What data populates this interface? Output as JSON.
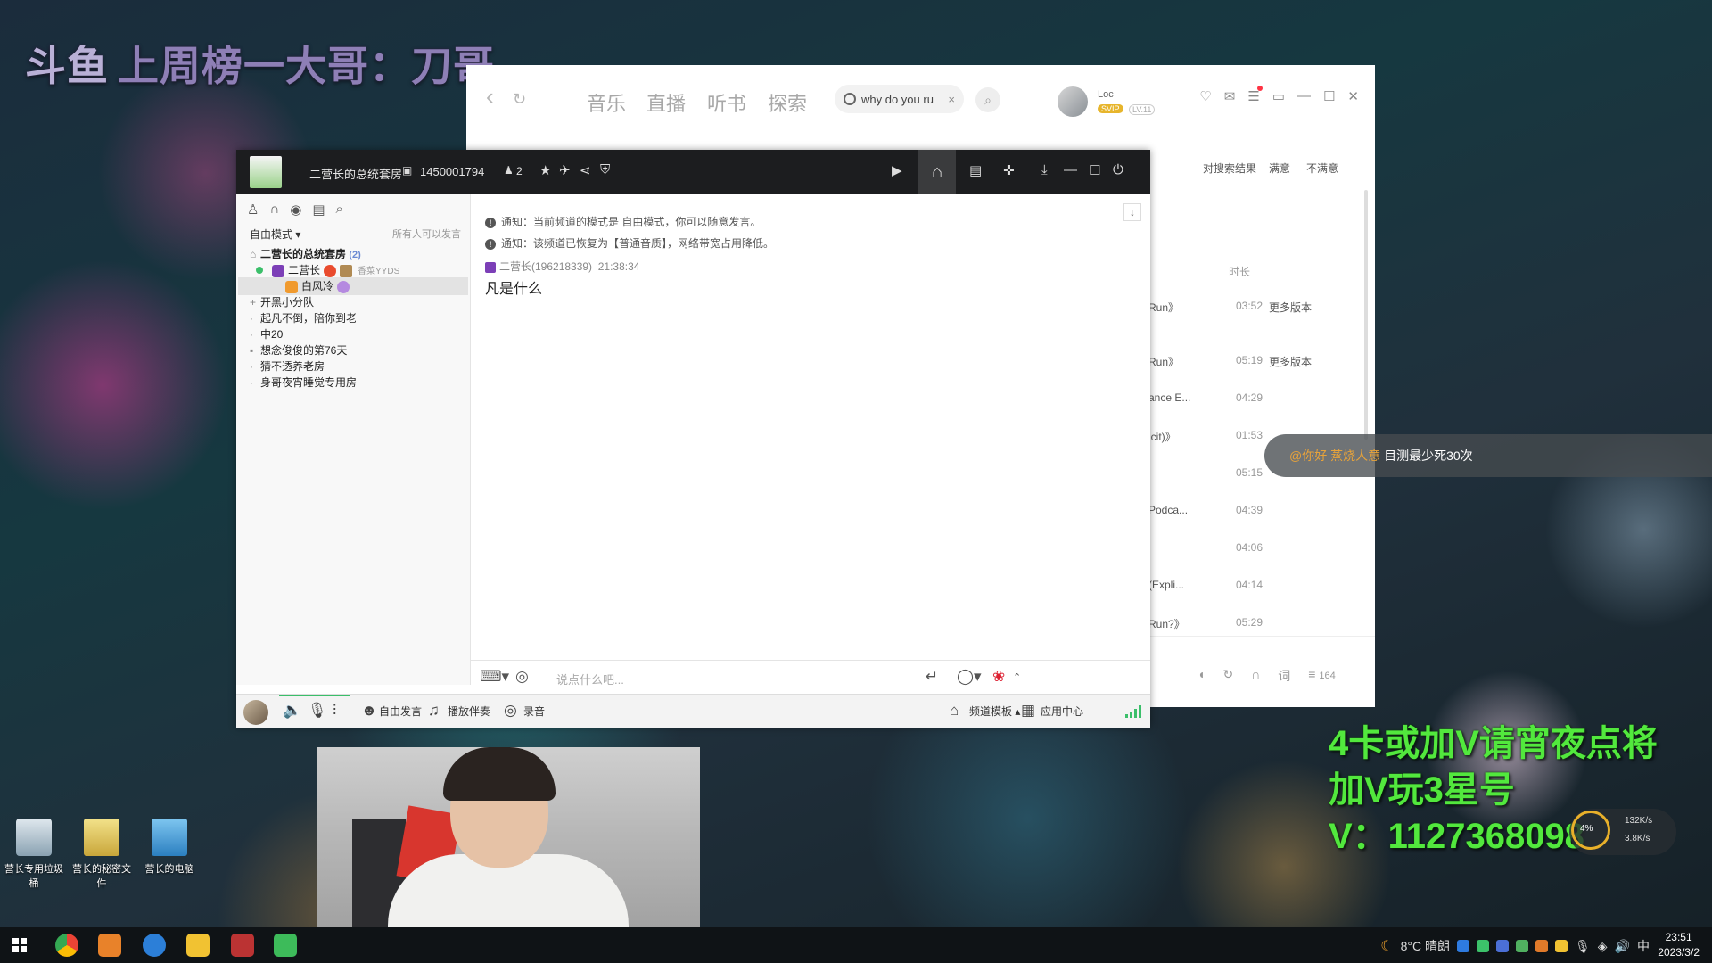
{
  "overlay_top": {
    "logo": "斗鱼",
    "text": "上周榜一大哥：刀哥"
  },
  "music_app": {
    "tabs": [
      "音乐",
      "直播",
      "听书",
      "探索"
    ],
    "search_value": "why do you ru",
    "user_name": "Loc",
    "svip": "SVIP",
    "level": "LV.11",
    "feedback": {
      "question": "对搜索结果",
      "satisfied": "满意",
      "unsatisfied": "不满意"
    },
    "duration_header": "时长",
    "songs": [
      {
        "title": "Run》",
        "duration": "03:52",
        "more": "更多版本"
      },
      {
        "title": "Run》",
        "duration": "05:19",
        "more": "更多版本"
      },
      {
        "title": "ance E...",
        "duration": "04:29",
        "more": ""
      },
      {
        "title": "icit)》",
        "duration": "01:53",
        "more": ""
      },
      {
        "title": "",
        "duration": "05:15",
        "more": ""
      },
      {
        "title": "Podca...",
        "duration": "04:39",
        "more": ""
      },
      {
        "title": "",
        "duration": "04:06",
        "more": ""
      },
      {
        "title": "(Expli...",
        "duration": "04:14",
        "more": ""
      },
      {
        "title": "Run?》",
        "duration": "05:29",
        "more": ""
      }
    ],
    "playlist_count": "164"
  },
  "chat_pill": {
    "user": "@你好 蒸烧人意",
    "message": "目测最少死30次"
  },
  "yy": {
    "room_name": "二营长的总统套房",
    "room_id": "1450001794",
    "online_count": "2",
    "mode": "自由模式",
    "permission": "所有人可以发言",
    "channel_main": "二营长的总统套房",
    "channel_main_count": "(2)",
    "members": [
      {
        "name": "二营长",
        "tag": "香菜YYDS"
      },
      {
        "name": "白风冷",
        "tag": ""
      }
    ],
    "sub_channels": [
      "开黑小分队",
      "起凡不倒，陪你到老",
      "中20",
      "想念俊俊的第76天",
      "猜不透养老房",
      "身哥夜宵睡觉专用房"
    ],
    "notices": [
      "通知：当前频道的模式是 自由模式，你可以随意发言。",
      "通知：该频道已恢复为【普通音质】，网络带宽占用降低。"
    ],
    "message": {
      "sender": "二营长(196218339)",
      "time": "21:38:34",
      "text": "凡是什么"
    },
    "input_placeholder": "说点什么吧...",
    "bottom": {
      "free_speak": "自由发言",
      "play_accompany": "播放伴奏",
      "record": "录音",
      "template": "频道模板",
      "app_center": "应用中心"
    }
  },
  "desktop_icons": [
    {
      "label": "营长专用垃圾桶"
    },
    {
      "label": "营长的秘密文件"
    },
    {
      "label": "营长的电脑"
    }
  ],
  "overlay_right": {
    "line1": "4卡或加V请宵夜点将",
    "line2": "加V玩3星号",
    "line3": "V：1127368098"
  },
  "netspeed": {
    "percent": "4%",
    "up": "132K/s",
    "down": "3.8K/s"
  },
  "taskbar": {
    "weather": "8°C 晴朗",
    "ime": "中",
    "time": "23:51",
    "date": "2023/3/2"
  }
}
